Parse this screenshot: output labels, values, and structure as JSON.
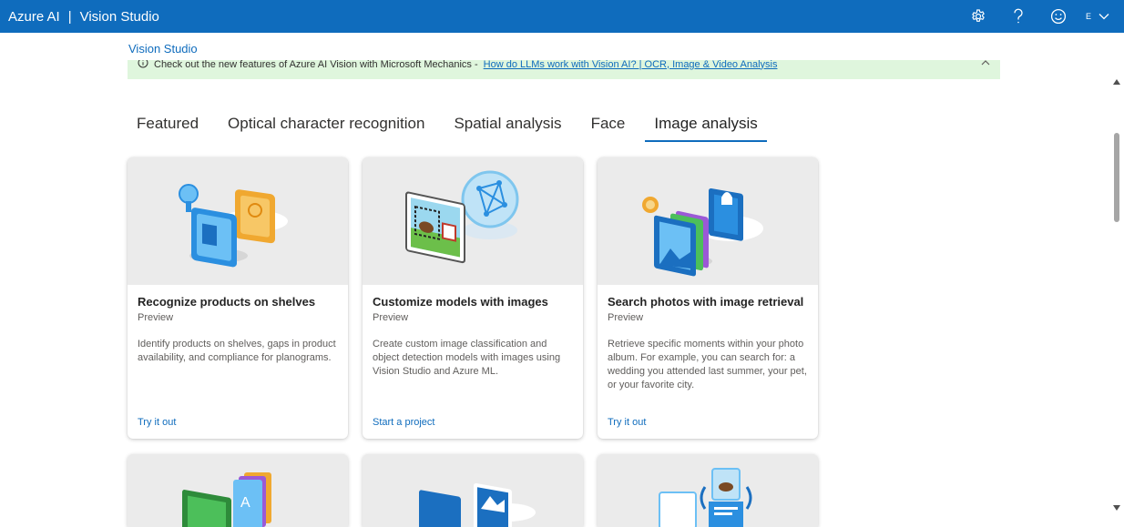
{
  "header": {
    "brand": "Azure AI",
    "separator": "|",
    "product": "Vision Studio",
    "user_initial": "E",
    "icons": [
      "settings-icon",
      "help-icon",
      "feedback-smiley-icon",
      "chevron-down-icon"
    ]
  },
  "breadcrumb": "Vision Studio",
  "banner": {
    "text": "Check out the new features of Azure AI Vision with Microsoft Mechanics -",
    "link": "How do LLMs work with Vision AI? | OCR, Image & Video Analysis"
  },
  "tabs": [
    {
      "label": "Featured",
      "active": false
    },
    {
      "label": "Optical character recognition",
      "active": false
    },
    {
      "label": "Spatial analysis",
      "active": false
    },
    {
      "label": "Face",
      "active": false
    },
    {
      "label": "Image analysis",
      "active": true
    }
  ],
  "cards": [
    {
      "title": "Recognize products on shelves",
      "badge": "Preview",
      "description": "Identify products on shelves, gaps in product availability, and compliance for planograms.",
      "action": "Try it out"
    },
    {
      "title": "Customize models with images",
      "badge": "Preview",
      "description": "Create custom image classification and object detection models with images using Vision Studio and Azure ML.",
      "action": "Start a project"
    },
    {
      "title": "Search photos with image retrieval",
      "badge": "Preview",
      "description": "Retrieve specific moments within your photo album. For example, you can search for: a wedding you attended last summer, your pet, or your favorite city.",
      "action": "Try it out"
    }
  ],
  "colors": {
    "header": "#0f6cbd",
    "banner": "#dff6dd",
    "link": "#0f6cbd",
    "card_art_bg": "#ebebeb"
  }
}
